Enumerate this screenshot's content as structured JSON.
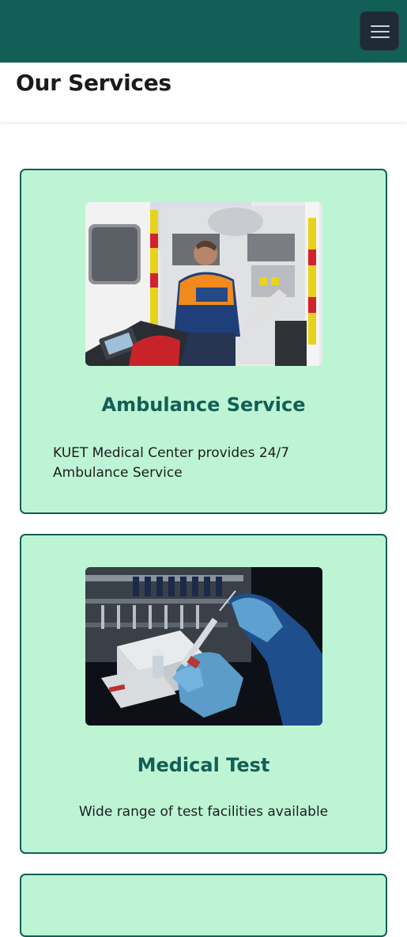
{
  "header": {
    "menu_icon": "hamburger-menu-icon",
    "colors": {
      "navbar": "#125f58",
      "menu_button": "#1f2a37"
    }
  },
  "page": {
    "title": "Our Services"
  },
  "services": [
    {
      "title": "Ambulance Service",
      "description": "KUET Medical Center provides 24/7 Ambulance Service",
      "image": "ambulance-interior-photo"
    },
    {
      "title": "Medical Test",
      "description": "Wide range of test facilities available",
      "image": "lab-test-gloved-hands-photo"
    }
  ],
  "colors": {
    "card_bg": "#bdf5d4",
    "card_border": "#145e55",
    "card_title": "#135e55"
  }
}
